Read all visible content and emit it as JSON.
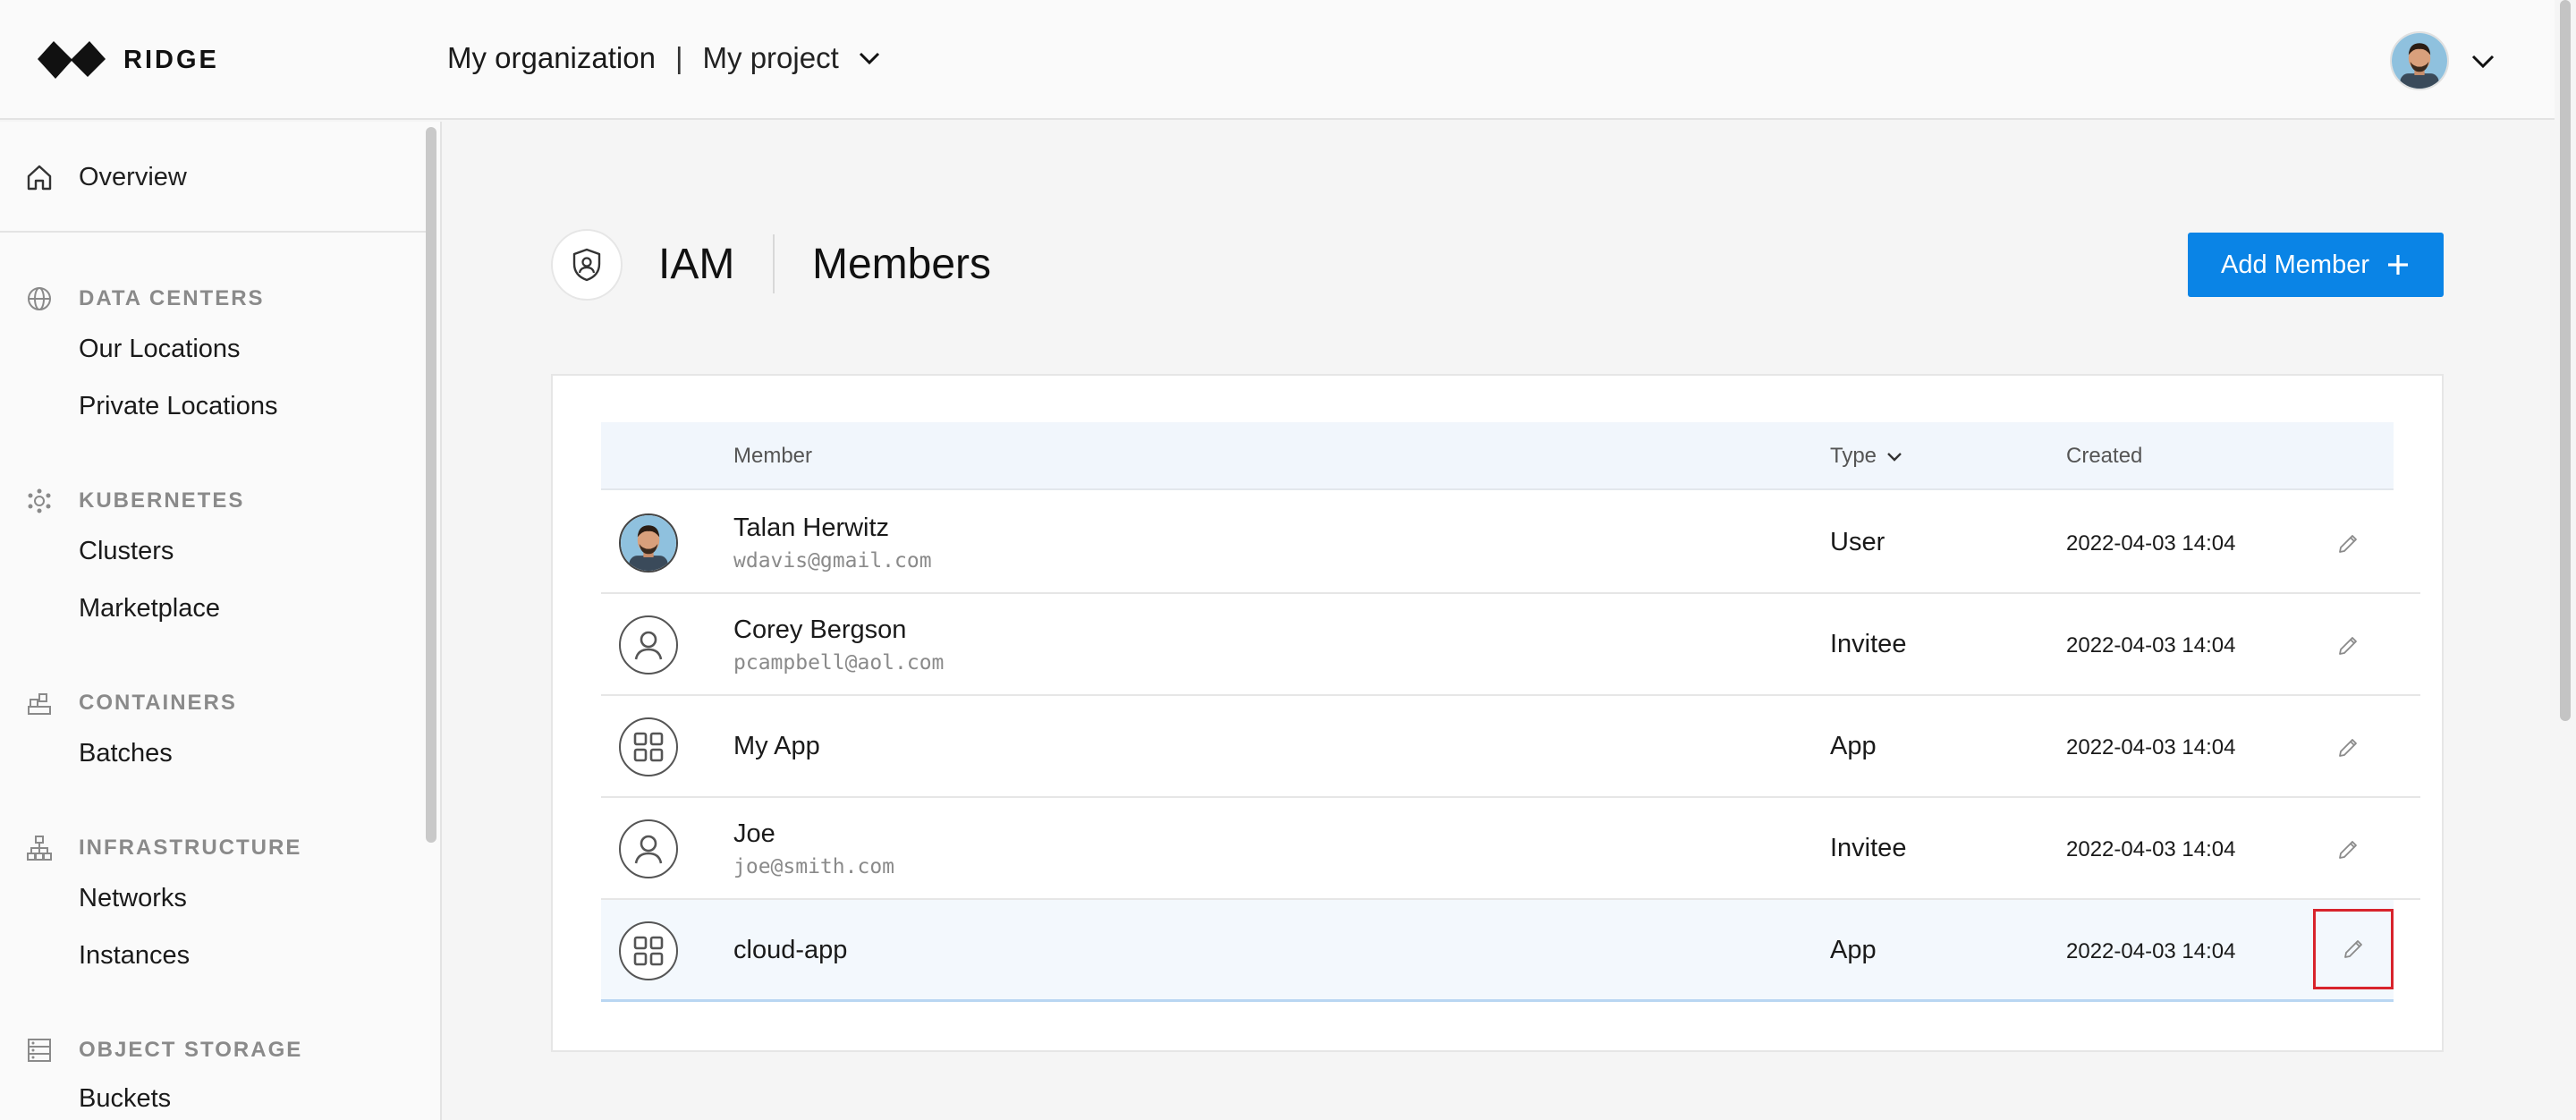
{
  "app": {
    "brand": "RIDGE",
    "organization": "My organization",
    "separator": "|",
    "project": "My project"
  },
  "sidebar": {
    "overview": "Overview",
    "sections": [
      {
        "title": "DATA CENTERS",
        "icon": "globe-icon",
        "items": [
          "Our Locations",
          "Private Locations"
        ]
      },
      {
        "title": "KUBERNETES",
        "icon": "kubernetes-icon",
        "items": [
          "Clusters",
          "Marketplace"
        ]
      },
      {
        "title": "CONTAINERS",
        "icon": "containers-icon",
        "items": [
          "Batches"
        ]
      },
      {
        "title": "INFRASTRUCTURE",
        "icon": "network-tree-icon",
        "items": [
          "Networks",
          "Instances"
        ]
      },
      {
        "title": "OBJECT STORAGE",
        "icon": "storage-icon",
        "items": [
          "Buckets"
        ]
      }
    ]
  },
  "header": {
    "section": "IAM",
    "page": "Members",
    "add_button": "Add Member"
  },
  "table": {
    "columns": {
      "member": "Member",
      "type": "Type",
      "created": "Created"
    },
    "rows": [
      {
        "name": "Talan Herwitz",
        "email": "wdavis@gmail.com",
        "type": "User",
        "created": "2022-04-03 14:04",
        "avatar": "photo"
      },
      {
        "name": "Corey Bergson",
        "email": "pcampbell@aol.com",
        "type": "Invitee",
        "created": "2022-04-03 14:04",
        "avatar": "person-icon"
      },
      {
        "name": "My App",
        "email": "",
        "type": "App",
        "created": "2022-04-03 14:04",
        "avatar": "app-grid-icon"
      },
      {
        "name": "Joe",
        "email": "joe@smith.com",
        "type": "Invitee",
        "created": "2022-04-03 14:04",
        "avatar": "person-icon"
      },
      {
        "name": "cloud-app",
        "email": "",
        "type": "App",
        "created": "2022-04-03 14:04",
        "avatar": "app-grid-icon"
      }
    ]
  },
  "colors": {
    "accent": "#0a84e6",
    "highlight": "#d8242c"
  }
}
